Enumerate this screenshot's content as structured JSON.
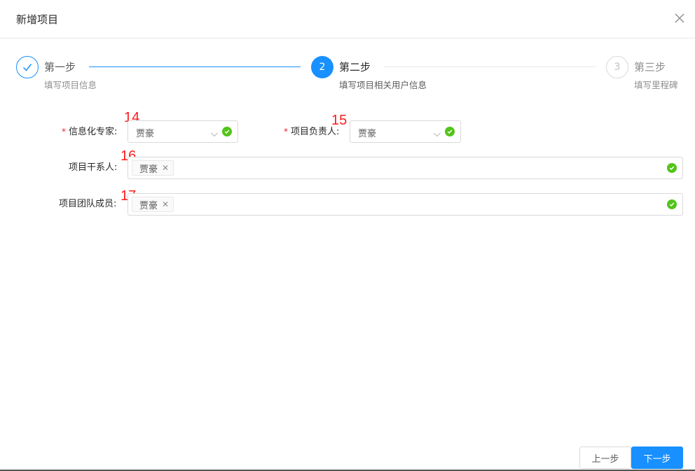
{
  "modal": {
    "title": "新增项目",
    "close_icon": "close-icon"
  },
  "steps": [
    {
      "index": "1",
      "title": "第一步",
      "description": "填写项目信息",
      "status": "finish",
      "icon": "check-icon"
    },
    {
      "index": "2",
      "title": "第二步",
      "description": "填写项目相关用户信息",
      "status": "process"
    },
    {
      "index": "3",
      "title": "第三步",
      "description": "填写里程碑",
      "status": "wait"
    }
  ],
  "form": {
    "it_expert": {
      "label": "信息化专家:",
      "required_mark": "*",
      "value": "贾豪",
      "annotation": "14"
    },
    "project_lead": {
      "label": "项目负责人:",
      "required_mark": "*",
      "value": "贾豪",
      "annotation": "15"
    },
    "stakeholders": {
      "label": "项目干系人:",
      "tags": [
        "贾豪"
      ],
      "annotation": "16"
    },
    "team_members": {
      "label": "项目团队成员:",
      "tags": [
        "贾豪"
      ],
      "annotation": "17"
    }
  },
  "footer": {
    "prev_label": "上一步",
    "next_label": "下一步"
  },
  "colors": {
    "primary": "#1890ff",
    "success": "#52c41a",
    "required": "#f5222d",
    "annotation": "#ff1b1b"
  }
}
